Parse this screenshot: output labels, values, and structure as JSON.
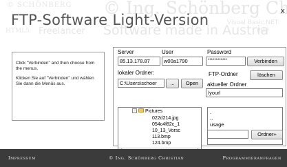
{
  "header": {
    "title": "FTP-Software Light-Version",
    "close_glyph": "x",
    "watermarks": {
      "top_left": "© SCHÖNBERG",
      "big": "© Ing. Schönberg Christian",
      "html": "HTML5",
      "freelancer": "Freelancer",
      "made": "Software made in Austria",
      "vb": "Visual Basic.NET",
      "php": "PHP"
    }
  },
  "info": {
    "line1": "Click \"Verbinden\" and then choose from the menus.",
    "line2": "Klicken Sie auf \"Verbinden\" und wählen Sie dann die Menüs aus."
  },
  "connect": {
    "server_label": "Server",
    "user_label": "User",
    "password_label": "Password",
    "server_value": "85.13.178.87",
    "user_value": "w00a1790",
    "password_value": "************",
    "connect_button": "Verbinden"
  },
  "local": {
    "label": "lokaler Ordner:",
    "path_value": "C:\\Users\\schoer",
    "browse_button": "...",
    "open_button": "Open",
    "tree": {
      "root": "Pictures",
      "items": [
        "022d214.jpg",
        "054c4f82c_1",
        "10_13_Vorsc",
        "113.bmp",
        "124.bmp"
      ]
    },
    "scroll_left": "<",
    "scroll_right": ">"
  },
  "remote": {
    "ftp_label": "FTP-Ordner",
    "delete_button": "löschen",
    "current_label": "aktueller Ordner",
    "path_value": "/yourl",
    "items": [
      ".",
      "..",
      "usage"
    ],
    "new_folder_value": "",
    "new_folder_button": "Ordner+"
  },
  "footer": {
    "impressum": "Impressum",
    "copyright": "© Ing. Schönberg Christian",
    "programming": "Programmieranfragen"
  }
}
